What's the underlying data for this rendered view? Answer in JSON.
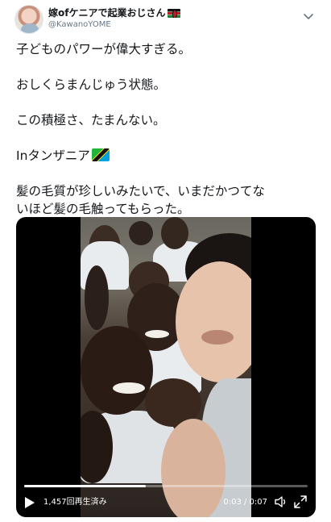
{
  "tweet": {
    "author": {
      "display_name": "嫁ofケニアで起業おじさん",
      "flag_icon": "kenya-flag-icon",
      "handle": "@KawanoYOME"
    },
    "menu_icon": "chevron-down-icon",
    "text_lines": [
      "子どものパワーが偉大すぎる。",
      "おしくらまんじゅう状態。",
      "この積極さ、たまんない。",
      "Inタンザニア",
      "髪の毛質が珍しいみたいで、いまだかつてな",
      "いほど髪の毛触ってもらった。"
    ],
    "inline_flag_icon": "tanzania-flag-icon"
  },
  "video": {
    "view_count": "1,457回再生済み",
    "time_display": "0:03 / 0:07",
    "progress_fraction": 0.43,
    "icons": {
      "play": "play-icon",
      "volume": "volume-icon",
      "fullscreen": "fullscreen-icon"
    }
  }
}
